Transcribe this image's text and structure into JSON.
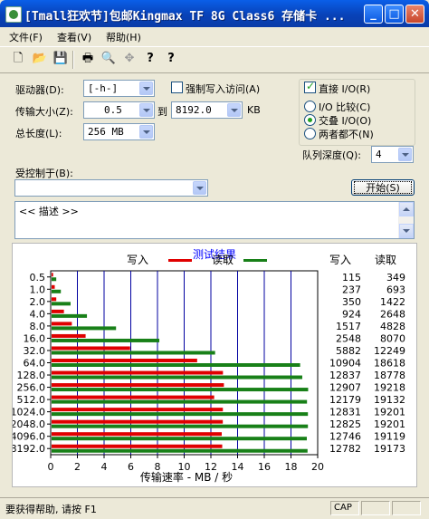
{
  "window": {
    "title": "[Tmall狂欢节]包邮Kingmax TF 8G Class6 存储卡 ...",
    "min_glyph": "_",
    "max_glyph": "□",
    "close_glyph": "✕"
  },
  "menu": [
    "文件(F)",
    "查看(V)",
    "帮助(H)"
  ],
  "toolbar": {
    "icons": [
      "new-file-icon",
      "open-folder-icon",
      "save-icon",
      "print-icon",
      "print-preview-icon",
      "move-icon",
      "help-icon",
      "context-help-icon"
    ],
    "glyphs": [
      "🗋",
      "📂",
      "💾",
      "🖶",
      "🔍",
      "✥",
      "?",
      "?"
    ]
  },
  "form": {
    "drive_label": "驱动器(D):",
    "drive_value": "[-h-]",
    "force_write_label": "强制写入访问(A)",
    "direct_io_label": "直接 I/O(R)",
    "transfer_size_label": "传输大小(Z):",
    "transfer_from": "0.5",
    "to_label": "到",
    "transfer_to": "8192.0",
    "unit_kb": "KB",
    "total_length_label": "总长度(L):",
    "total_length_value": "256 MB",
    "radio_compare": "I/O 比较(C)",
    "radio_overlap": "交叠 I/O(O)",
    "radio_neither": "两者都不(N)",
    "queue_depth_label": "队列深度(Q):",
    "queue_depth_value": "4",
    "controlled_by_label": "受控制于(B):",
    "controlled_by_value": "",
    "start_button": "开始(S)",
    "description": "<< 描述 >>"
  },
  "results": {
    "title": "测试结果",
    "legend_write": "写入",
    "legend_read": "读取",
    "col_write": "写入",
    "col_read": "读取"
  },
  "colors": {
    "write": "#E00000",
    "read": "#188018",
    "grid": "#0000A0",
    "title": "#0000FF"
  },
  "chart_data": {
    "type": "bar",
    "orientation": "horizontal",
    "categories": [
      "0.5",
      "1.0",
      "2.0",
      "4.0",
      "8.0",
      "16.0",
      "32.0",
      "64.0",
      "128.0",
      "256.0",
      "512.0",
      "1024.0",
      "2048.0",
      "4096.0",
      "8192.0"
    ],
    "series": [
      {
        "name": "写入",
        "values": [
          115,
          237,
          350,
          924,
          1517,
          2548,
          5882,
          10904,
          12837,
          12907,
          12179,
          12831,
          12825,
          12746,
          12782
        ]
      },
      {
        "name": "读取",
        "values": [
          349,
          693,
          1422,
          2648,
          4828,
          8070,
          12249,
          18618,
          18778,
          19218,
          19132,
          19201,
          19201,
          19119,
          19173
        ]
      }
    ],
    "xlabel": "传输速率 - MB / 秒",
    "xticks": [
      "0",
      "2",
      "4",
      "6",
      "8",
      "10",
      "12",
      "14",
      "16",
      "18",
      "20"
    ],
    "xlim": [
      0,
      20
    ],
    "value_unit_scale": 1000,
    "grid": true,
    "legend": "top"
  },
  "status": {
    "help_text": "要获得帮助, 请按 F1",
    "cap": "CAP",
    "num": ""
  }
}
